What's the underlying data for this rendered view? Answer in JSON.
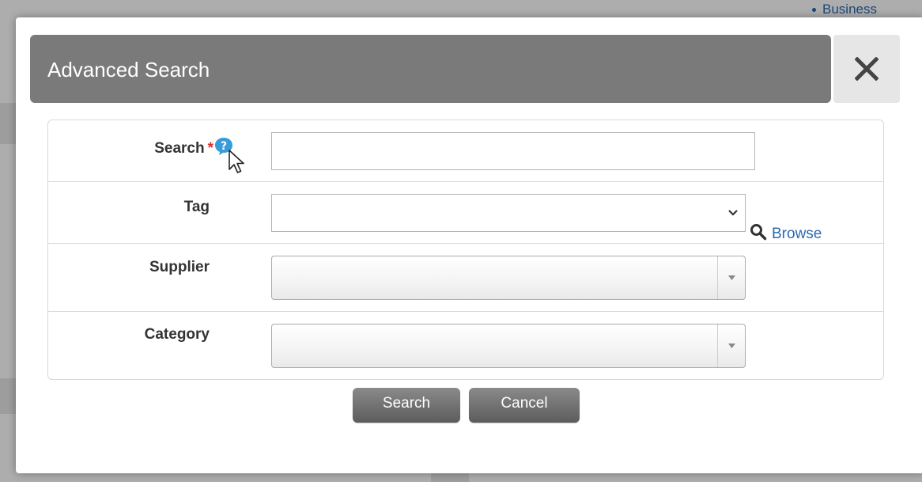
{
  "background": {
    "link_text": "Business"
  },
  "modal": {
    "title": "Advanced Search",
    "close_icon": "close-icon"
  },
  "form": {
    "search": {
      "label": "Search",
      "required_mark": "*",
      "help_icon": "question-icon",
      "value": "",
      "placeholder": ""
    },
    "tag": {
      "label": "Tag",
      "selected": ""
    },
    "supplier": {
      "label": "Supplier",
      "selected": ""
    },
    "category": {
      "label": "Category",
      "selected": "",
      "browse_label": "Browse",
      "browse_icon": "magnifier-icon"
    }
  },
  "buttons": {
    "search_label": "Search",
    "cancel_label": "Cancel"
  },
  "colors": {
    "header_bg": "#7a7a7a",
    "link": "#2a6ab0",
    "required": "#d9302f",
    "help": "#3a9bd9"
  }
}
